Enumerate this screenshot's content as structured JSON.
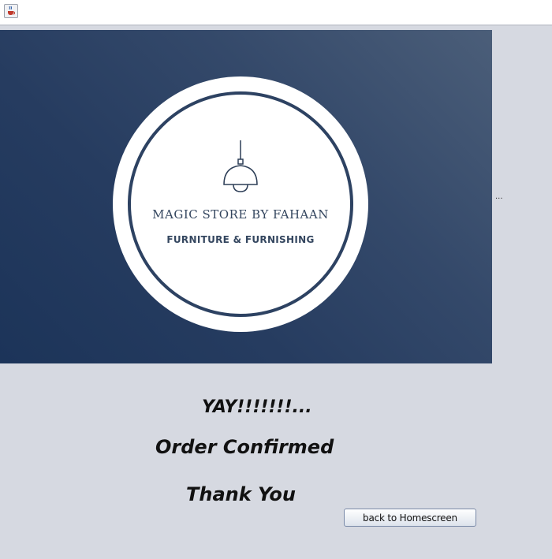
{
  "window": {
    "app_icon": "java-cup-icon"
  },
  "banner": {
    "logo_icon": "pendant-lamp-icon",
    "logo_title": "MAGIC STORE BY FAHAAN",
    "logo_subtitle": "FURNITURE & FURNISHING"
  },
  "side_label": "...",
  "message": {
    "yay": "YAY!!!!!!!...",
    "order": "Order Confirmed",
    "thanks": "Thank You"
  },
  "actions": {
    "back_label": "back to Homescreen"
  },
  "colors": {
    "background": "#d6d9e1",
    "banner_dark": "#1c3459",
    "banner_light": "#4b5e79",
    "logo_ink": "#34465f"
  }
}
